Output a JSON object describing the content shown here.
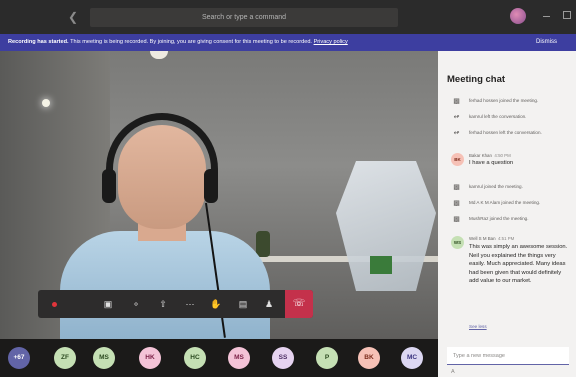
{
  "titlebar": {
    "search_placeholder": "Search or type a command"
  },
  "banner": {
    "title": "Recording has started.",
    "message": "This meeting is being recorded. By joining, you are giving consent for this meeting to be recorded.",
    "privacy_link": "Privacy policy",
    "dismiss_label": "Dismiss"
  },
  "colors": {
    "banner_bg": "#3d3ea0",
    "hangup": "#c4314b",
    "accent": "#6264a7"
  },
  "participants": {
    "overflow_label": "+67",
    "avatars": [
      {
        "initials": "ZF",
        "bg": "#c5e0b4",
        "fg": "#2b4a1f"
      },
      {
        "initials": "MS",
        "bg": "#c5e0b4",
        "fg": "#2b4a1f"
      },
      {
        "initials": "HK",
        "bg": "#f4c3d7",
        "fg": "#7a1f45"
      },
      {
        "initials": "HC",
        "bg": "#c5e0b4",
        "fg": "#2b4a1f"
      },
      {
        "initials": "MS",
        "bg": "#f4c3d7",
        "fg": "#7a1f45"
      },
      {
        "initials": "SS",
        "bg": "#e6d3f0",
        "fg": "#4b2d63"
      },
      {
        "initials": "P",
        "bg": "#c5e0b4",
        "fg": "#2b4a1f"
      },
      {
        "initials": "BK",
        "bg": "#f6c1b6",
        "fg": "#7a2a1a"
      },
      {
        "initials": "MC",
        "bg": "#dcd7f2",
        "fg": "#3b3480"
      }
    ]
  },
  "chat": {
    "title": "Meeting chat",
    "events_top": [
      {
        "icon": "person-joined-icon",
        "text": "ferhad hossen joined the meeting."
      },
      {
        "icon": "person-left-icon",
        "text": "kamrul left the conversation."
      },
      {
        "icon": "person-left-icon",
        "text": "ferhad hossen left the conversation."
      }
    ],
    "message1": {
      "initials": "BK",
      "sender": "Bakar Khan",
      "time": "4:50 PM",
      "text": "I have a question"
    },
    "events_mid": [
      {
        "icon": "person-joined-icon",
        "text": "kamrul joined the meeting."
      },
      {
        "icon": "person-joined-icon",
        "text": "Md A K M Alam joined the meeting."
      },
      {
        "icon": "person-joined-icon",
        "text": "MushRaz joined the meeting."
      }
    ],
    "message2": {
      "initials": "WS",
      "sender": "Well S M Ban",
      "time": "4:51 PM",
      "text": "This was simply an awesome session. Neil you explained the things very easily. Much appreciated. Many ideas had been given that would definitely add value to our market."
    },
    "see_less": "See less",
    "compose_placeholder": "Type a new message",
    "compose_hint": "A"
  }
}
